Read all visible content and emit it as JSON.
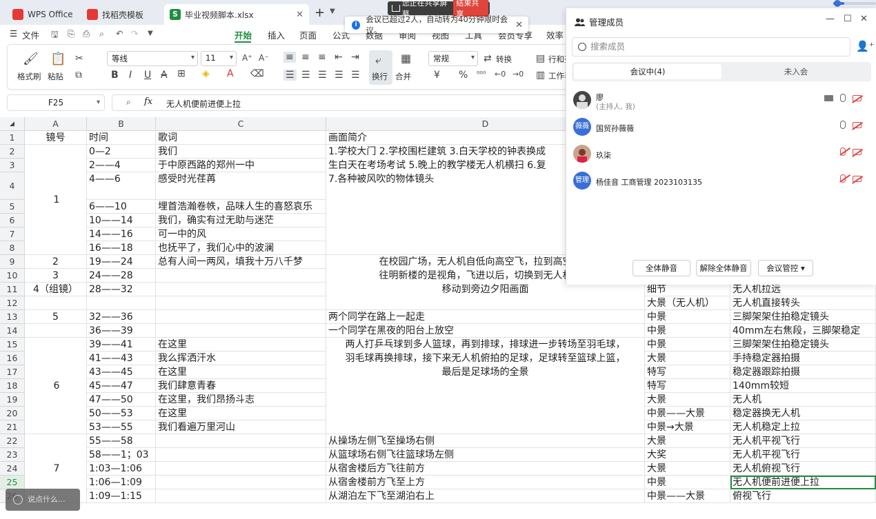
{
  "tabs": [
    {
      "label": "WPS Office",
      "color": "#e53935"
    },
    {
      "label": "找稻壳模板",
      "color": "#e53935"
    },
    {
      "label": "毕业视频脚本.xlsx",
      "color": "#1d8e3e",
      "icon_text": "S"
    }
  ],
  "share": {
    "text": "您正在共享屏幕",
    "end": "结束共享"
  },
  "notice": {
    "text": "会议已超过2人，自动转为40分钟限时会议。"
  },
  "menu": {
    "file": "文件",
    "items": [
      "开始",
      "插入",
      "页面",
      "公式",
      "数据",
      "审阅",
      "视图",
      "工具",
      "会员专享",
      "效率"
    ],
    "active": "开始"
  },
  "ribbon": {
    "format_painter": "格式刷",
    "paste": "粘贴",
    "font": "等线",
    "size": "11",
    "wrap": "换行",
    "merge": "合并",
    "number_format": "常规",
    "convert": "转换",
    "rows_cols": "行和列",
    "worksheet": "工作表"
  },
  "formula": {
    "cell": "F25",
    "content": "无人机便前进便上拉"
  },
  "columns": [
    "A",
    "B",
    "C",
    "D"
  ],
  "header_row": {
    "a": "镜号",
    "b": "时间",
    "c": "歌词",
    "d": "画面简介"
  },
  "row_numbers": [
    "1",
    "2",
    "3",
    "4",
    "5",
    "6",
    "7",
    "8",
    "9",
    "10",
    "11",
    "12",
    "13",
    "14",
    "15",
    "16",
    "17",
    "18",
    "19",
    "20",
    "21",
    "22",
    "23",
    "24",
    "25",
    "26"
  ],
  "col_b": [
    "0—2",
    "2——4",
    "4——6",
    "6——10",
    "10——14",
    "14——16",
    "16——18",
    "19——24",
    "24——28",
    "28——32",
    "",
    "32——36",
    "36——39",
    "39——41",
    "41——43",
    "43——45",
    "45——47",
    "47——50",
    "50——53",
    "53——55",
    "55——58",
    "58——1；03",
    "1:03—1:06",
    "1:06—1:09",
    "1:09—1:15"
  ],
  "col_c": [
    "我们",
    "于中原西路的郑州一中",
    "感受时光荏苒",
    "埋首浩瀚卷帙，品味人生的喜怒哀乐",
    "我们，确实有过无助与迷茫",
    "可一中的风",
    "也抚平了，我们心中的波澜",
    "总有人间一两风，填我十万八千梦",
    "",
    "",
    "",
    "",
    "",
    "在这里",
    "我么挥洒汗水",
    "在这里",
    "我们肆意青春",
    "在这里，我们昂扬斗志",
    "在这里",
    "我们看遍万里河山",
    "",
    "",
    "",
    "",
    ""
  ],
  "col_a_merged": {
    "r2_8": "1",
    "r9": "2",
    "r10": "3",
    "r11": "4（组镜）",
    "r13": "5",
    "r15_21": "6",
    "r22_26": "7"
  },
  "col_d": {
    "r2": "1.学校大门  2.学校围栏建筑  3.白天学校的钟表换成",
    "r3": "生白天在考场考试  5.晚上的教学楼无人机横扫    6.复",
    "r4": "7.各种被风吹的物体镜头",
    "r9": "在校园广场，无人机自低向高空飞，拉到高空后，",
    "r10": "往明新楼的是视角，飞进以后，切换到无人机从明",
    "r11": "移动到旁边夕阳画面",
    "r13": "两个同学在路上一起走",
    "r14": "一个同学在黑夜的阳台上放空",
    "r15": "两人打乒乓球到多人篮球，再到排球，排球进一步转场至羽毛球，",
    "r16": "羽毛球再换排球，接下来无人机俯拍的足球，足球转至篮球上篮，",
    "r17": "最后是足球场的全景",
    "r22": "从操场左侧飞至操场右侧",
    "r23": "从篮球场右侧飞往篮球场左侧",
    "r24": "从宿舍楼后方飞往前方",
    "r25": "从宿舍楼前方飞至上方",
    "r26": "从湖泊左下飞至湖泊右上"
  },
  "col_e": [
    "细节",
    "大景（无人机）",
    "中景",
    "中景",
    "中景",
    "大景",
    "特写",
    "特写",
    "大景",
    "中景——大景",
    "中景→大景",
    "大景",
    "大奖",
    "大景",
    "中景",
    "中景——大景"
  ],
  "col_f": [
    "无人机拉远",
    "无人机直接转头",
    "三脚架架住拍稳定镜头",
    "40mm左右焦段，三脚架稳定",
    "三脚架架住拍稳定镜头",
    "手持稳定器拍摄",
    "稳定器跟踪拍摄",
    "140mm较短",
    "无人机",
    "稳定器换无人机",
    "无人机稳定上拉",
    "无人机平视飞行",
    "无人机平视飞行",
    "无人机俯视飞行",
    "无人机便前进便上拉",
    "俯视飞行"
  ],
  "panel": {
    "title": "管理成员",
    "search_placeholder": "搜索成员",
    "tab_in": "会议中(4)",
    "tab_out": "未入会",
    "members": [
      {
        "name": "廖",
        "role": "(主持人, 我)",
        "avatar": "",
        "color": "#333"
      },
      {
        "name": "国贸孙薇薇",
        "role": "",
        "avatar": "薇薇",
        "color": "#3b6fd8"
      },
      {
        "name": "玖柒",
        "role": "",
        "avatar": "",
        "color": "#c44"
      },
      {
        "name": "杨佳音 工商管理 2023103135",
        "role": "",
        "avatar": "管理",
        "color": "#3b6fd8"
      }
    ],
    "mute_all": "全体静音",
    "unmute_all": "解除全体静音",
    "control": "会议管控"
  },
  "say": "说点什么..."
}
